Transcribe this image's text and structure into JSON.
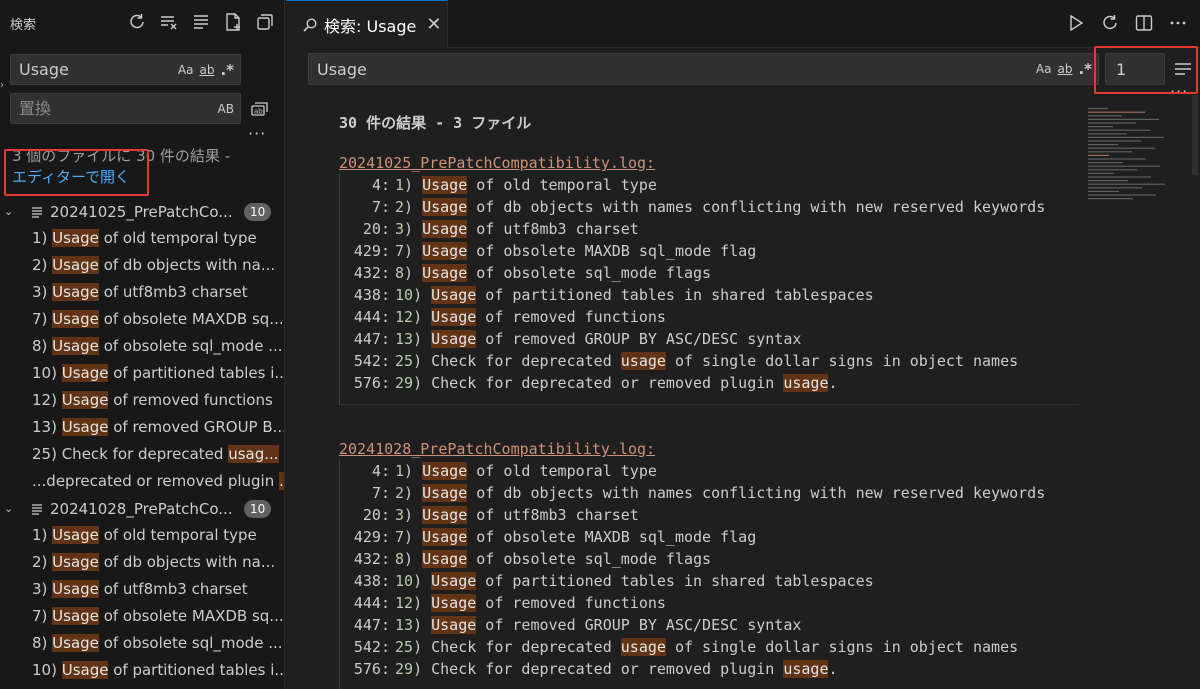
{
  "sidebar": {
    "title": "検索",
    "search": {
      "value": "Usage"
    },
    "replace": {
      "placeholder": "置換",
      "preserve_case_label": "AB"
    },
    "summary": "3 個のファイルに 30 件の結果 -",
    "open_in_editor": "エディターで開く",
    "match_case_label": "Aa",
    "whole_word_label": "ab",
    "regex_label": ".*",
    "files": [
      {
        "name": "20241025_PrePatchCo...",
        "count": "10",
        "matches": [
          {
            "pre": "1) ",
            "hit": "Usage",
            "post": " of old temporal type"
          },
          {
            "pre": "2) ",
            "hit": "Usage",
            "post": " of db objects with na..."
          },
          {
            "pre": "3) ",
            "hit": "Usage",
            "post": " of utf8mb3 charset"
          },
          {
            "pre": "7) ",
            "hit": "Usage",
            "post": " of obsolete MAXDB sq..."
          },
          {
            "pre": "8) ",
            "hit": "Usage",
            "post": " of obsolete sql_mode ..."
          },
          {
            "pre": "10) ",
            "hit": "Usage",
            "post": " of partitioned tables i..."
          },
          {
            "pre": "12) ",
            "hit": "Usage",
            "post": " of removed functions"
          },
          {
            "pre": "13) ",
            "hit": "Usage",
            "post": " of removed GROUP B..."
          },
          {
            "pre": "25) Check for deprecated ",
            "hit": "usag...",
            "post": ""
          },
          {
            "pre": "...deprecated or removed plugin ",
            "hit": "...",
            "post": ""
          }
        ]
      },
      {
        "name": "20241028_PrePatchCo...",
        "count": "10",
        "matches": [
          {
            "pre": "1) ",
            "hit": "Usage",
            "post": " of old temporal type"
          },
          {
            "pre": "2) ",
            "hit": "Usage",
            "post": " of db objects with na..."
          },
          {
            "pre": "3) ",
            "hit": "Usage",
            "post": " of utf8mb3 charset"
          },
          {
            "pre": "7) ",
            "hit": "Usage",
            "post": " of obsolete MAXDB sq..."
          },
          {
            "pre": "8) ",
            "hit": "Usage",
            "post": " of obsolete sql_mode ..."
          },
          {
            "pre": "10) ",
            "hit": "Usage",
            "post": " of partitioned tables i..."
          }
        ]
      }
    ]
  },
  "editor": {
    "tab_label": "検索: Usage",
    "search": {
      "value": "Usage"
    },
    "context_lines": "1",
    "match_case_label": "Aa",
    "whole_word_label": "ab",
    "regex_label": ".*",
    "result_summary": "30 件の結果 - 3 ファイル",
    "files": [
      {
        "name": "20241025_PrePatchCompatibility.log:",
        "lines": [
          {
            "ln": "4:",
            "num": "1",
            "pre": ") ",
            "hit": "Usage",
            "post": " of old temporal type",
            "hit2": "",
            "post2": ""
          },
          {
            "ln": "7:",
            "num": "2",
            "pre": ") ",
            "hit": "Usage",
            "post": " of db objects with names conflicting with new reserved keywords",
            "hit2": "",
            "post2": ""
          },
          {
            "ln": "20:",
            "num": "3",
            "pre": ") ",
            "hit": "Usage",
            "post": " of utf8mb3 charset",
            "hit2": "",
            "post2": ""
          },
          {
            "ln": "429:",
            "num": "7",
            "pre": ") ",
            "hit": "Usage",
            "post": " of obsolete MAXDB sql_mode flag",
            "hit2": "",
            "post2": ""
          },
          {
            "ln": "432:",
            "num": "8",
            "pre": ") ",
            "hit": "Usage",
            "post": " of obsolete sql_mode flags",
            "hit2": "",
            "post2": ""
          },
          {
            "ln": "438:",
            "num": "10",
            "pre": ") ",
            "hit": "Usage",
            "post": " of partitioned tables in shared tablespaces",
            "hit2": "",
            "post2": ""
          },
          {
            "ln": "444:",
            "num": "12",
            "pre": ") ",
            "hit": "Usage",
            "post": " of removed functions",
            "hit2": "",
            "post2": ""
          },
          {
            "ln": "447:",
            "num": "13",
            "pre": ") ",
            "hit": "Usage",
            "post": " of removed GROUP BY ASC/DESC syntax",
            "hit2": "",
            "post2": ""
          },
          {
            "ln": "542:",
            "num": "25",
            "pre": ") Check for deprecated ",
            "hit": "usage",
            "post": " of single dollar signs in object names",
            "hit2": "",
            "post2": ""
          },
          {
            "ln": "576:",
            "num": "29",
            "pre": ") Check for deprecated or removed plugin ",
            "hit": "usage",
            "post": ".",
            "hit2": "",
            "post2": ""
          }
        ]
      },
      {
        "name": "20241028_PrePatchCompatibility.log:",
        "lines": [
          {
            "ln": "4:",
            "num": "1",
            "pre": ") ",
            "hit": "Usage",
            "post": " of old temporal type",
            "hit2": "",
            "post2": ""
          },
          {
            "ln": "7:",
            "num": "2",
            "pre": ") ",
            "hit": "Usage",
            "post": " of db objects with names conflicting with new reserved keywords",
            "hit2": "",
            "post2": ""
          },
          {
            "ln": "20:",
            "num": "3",
            "pre": ") ",
            "hit": "Usage",
            "post": " of utf8mb3 charset",
            "hit2": "",
            "post2": ""
          },
          {
            "ln": "429:",
            "num": "7",
            "pre": ") ",
            "hit": "Usage",
            "post": " of obsolete MAXDB sql_mode flag",
            "hit2": "",
            "post2": ""
          },
          {
            "ln": "432:",
            "num": "8",
            "pre": ") ",
            "hit": "Usage",
            "post": " of obsolete sql_mode flags",
            "hit2": "",
            "post2": ""
          },
          {
            "ln": "438:",
            "num": "10",
            "pre": ") ",
            "hit": "Usage",
            "post": " of partitioned tables in shared tablespaces",
            "hit2": "",
            "post2": ""
          },
          {
            "ln": "444:",
            "num": "12",
            "pre": ") ",
            "hit": "Usage",
            "post": " of removed functions",
            "hit2": "",
            "post2": ""
          },
          {
            "ln": "447:",
            "num": "13",
            "pre": ") ",
            "hit": "Usage",
            "post": " of removed GROUP BY ASC/DESC syntax",
            "hit2": "",
            "post2": ""
          },
          {
            "ln": "542:",
            "num": "25",
            "pre": ") Check for deprecated ",
            "hit": "usage",
            "post": " of single dollar signs in object names",
            "hit2": "",
            "post2": ""
          },
          {
            "ln": "576:",
            "num": "29",
            "pre": ") Check for deprecated or removed plugin ",
            "hit": "usage",
            "post": ".",
            "hit2": "",
            "post2": ""
          }
        ]
      }
    ]
  },
  "colors": {
    "highlight_match": "#623315",
    "link": "#4daafc",
    "file_link": "#ce9178",
    "callout_border": "#e23b2e",
    "active_tab_border": "#0078d4"
  },
  "icons": {
    "sidebar_actions": [
      "refresh-icon",
      "clear-results-icon",
      "collapse-all-icon",
      "new-search-editor-icon",
      "view-as-tree-icon"
    ],
    "editor_actions": [
      "run-search-icon",
      "rerun-icon",
      "split-editor-icon",
      "more-actions-icon"
    ]
  }
}
